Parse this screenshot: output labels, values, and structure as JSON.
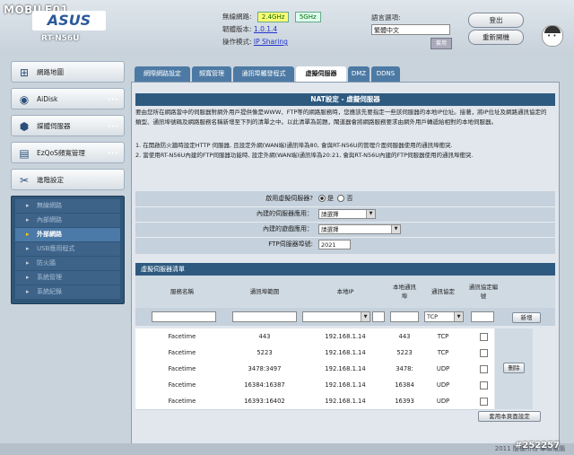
{
  "watermark": "MOBILE01",
  "brand": {
    "logo": "ASUS",
    "model": "RT-N56U"
  },
  "header": {
    "wireless_label": "無線網路:",
    "band_24": "2.4GHz",
    "band_5": "5GHz",
    "firmware_label": "韌體版本:",
    "firmware_value": "1.0.1.4",
    "mode_label": "操作模式:",
    "mode_value": "IP Sharing",
    "language_label": "語言選項:",
    "language_value": "繁體中文",
    "language_apply": "套用",
    "logout": "登出",
    "reboot": "重新開機"
  },
  "menu": {
    "items": [
      {
        "label": "網路地圖",
        "icon": "network-map-icon"
      },
      {
        "label": "AiDisk",
        "icon": "aidisk-icon"
      },
      {
        "label": "媒體伺服器",
        "icon": "media-server-icon"
      },
      {
        "label": "EzQoS頻寬管理",
        "icon": "qos-icon"
      },
      {
        "label": "進階設定",
        "icon": "tools-icon"
      }
    ],
    "sub": [
      "無線網路",
      "內部網路",
      "外部網路",
      "USB應用程式",
      "防火牆",
      "系統管理",
      "系統紀錄"
    ],
    "active_sub": 2
  },
  "tabs": [
    "網際網路設定",
    "頻寬管理",
    "通訊埠觸發程式",
    "虛擬伺服器",
    "DMZ",
    "DDNS"
  ],
  "active_tab": 3,
  "panel": {
    "title": "NAT設定 - 虛擬伺服器",
    "desc1": "要由您所在網路當中的伺服器對網外用戶提供像是WWW、FTP等的網路服務時，您應該先要指定一些該伺服器的本地IP位址。接著，將IP位址及網路通訊協定的類型、通訊埠號碼及網路服務名稱新增至下列的清單之中。以此清單為前題，閘道器會將網路服務要求由網外用戶轉遞給相對的本地伺服器。",
    "desc2": "1. 在開啟防火牆時設定HTTP 伺服器, 且設定外網(WAN端)通訊埠為80, 會與RT-N56U的管理介面伺服器使用的通訊埠衝突.",
    "desc3": "2. 當使用RT-N56U內建的FTP伺服器功能時, 設定外網(WAN端)通訊埠為20:21, 會與RT-N56U內建的FTP伺服器使用的通訊埠衝突."
  },
  "form": {
    "enable_label": "啟用虛擬伺服器?",
    "yes": "是",
    "no": "否",
    "known_server_label": "內建的伺服器應用：",
    "known_server_value": "請選擇",
    "known_game_label": "內建的遊戲應用：",
    "known_game_value": "請選擇",
    "ftp_port_label": "FTP伺服器埠號:",
    "ftp_port_value": "2021"
  },
  "list": {
    "title": "虛擬伺服器清單",
    "columns": [
      "服務名稱",
      "通訊埠範圍",
      "本地IP",
      "本地通訊埠",
      "通訊協定",
      "通訊協定編號"
    ],
    "protocol_default": "TCP",
    "add_button": "新增",
    "delete_button": "刪除",
    "apply_button": "套用本頁面設定",
    "rows": [
      {
        "name": "Facetime",
        "ports": "443",
        "ip": "192.168.1.14",
        "local_port": "443",
        "proto": "TCP"
      },
      {
        "name": "Facetime",
        "ports": "5223",
        "ip": "192.168.1.14",
        "local_port": "5223",
        "proto": "TCP"
      },
      {
        "name": "Facetime",
        "ports": "3478:3497",
        "ip": "192.168.1.14",
        "local_port": "3478:",
        "proto": "UDP"
      },
      {
        "name": "Facetime",
        "ports": "16384:16387",
        "ip": "192.168.1.14",
        "local_port": "16384",
        "proto": "UDP"
      },
      {
        "name": "Facetime",
        "ports": "16393:16402",
        "ip": "192.168.1.14",
        "local_port": "16393",
        "proto": "UDP"
      }
    ]
  },
  "footer": {
    "copyright": "2011 版權所有 華碩電腦",
    "stamp": "#252257"
  }
}
